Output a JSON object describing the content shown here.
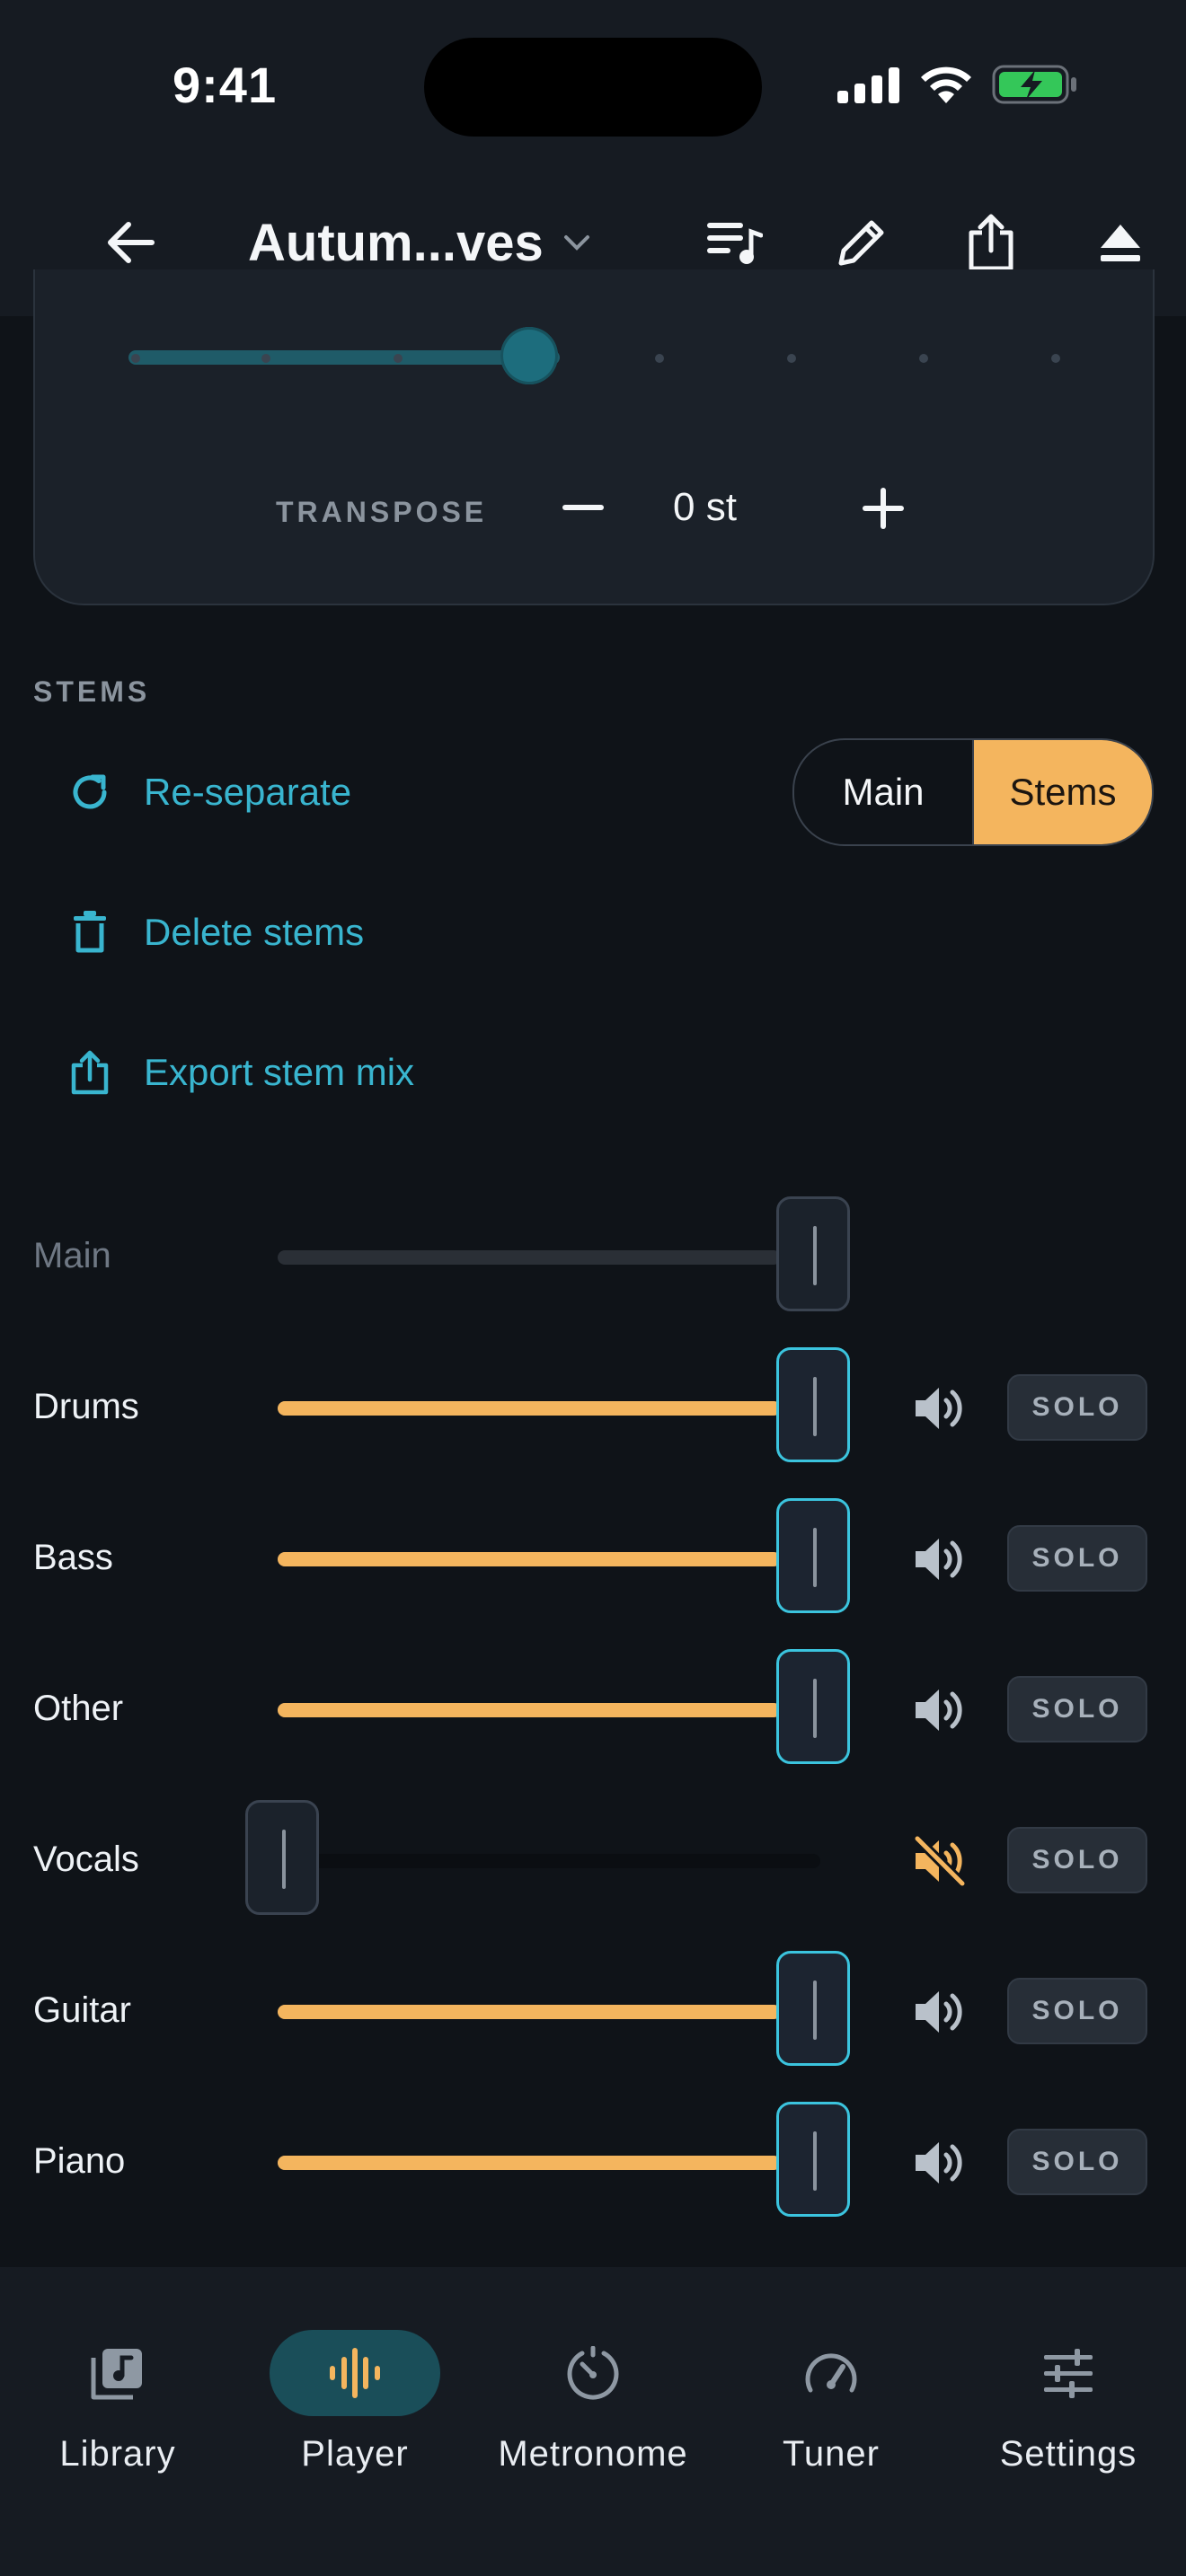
{
  "status_bar": {
    "time": "9:41"
  },
  "header": {
    "title": "Autum...ves"
  },
  "transpose": {
    "label": "TRANSPOSE",
    "value": "0 st"
  },
  "stems": {
    "section_label": "STEMS",
    "actions": [
      {
        "label": "Re-separate",
        "icon": "refresh-icon"
      },
      {
        "label": "Delete stems",
        "icon": "trash-icon"
      },
      {
        "label": "Export stem mix",
        "icon": "share-icon"
      }
    ],
    "mode_toggle": {
      "options": [
        "Main",
        "Stems"
      ],
      "selected": "Stems"
    },
    "solo_label": "SOLO",
    "rows": [
      {
        "name": "Main",
        "level": 1.0,
        "disabled": true
      },
      {
        "name": "Drums",
        "level": 1.0,
        "muted": false
      },
      {
        "name": "Bass",
        "level": 1.0,
        "muted": false
      },
      {
        "name": "Other",
        "level": 1.0,
        "muted": false
      },
      {
        "name": "Vocals",
        "level": 0.0,
        "muted": true
      },
      {
        "name": "Guitar",
        "level": 1.0,
        "muted": false
      },
      {
        "name": "Piano",
        "level": 1.0,
        "muted": false
      }
    ]
  },
  "nav": {
    "items": [
      {
        "label": "Library",
        "icon": "library-icon"
      },
      {
        "label": "Player",
        "icon": "waveform-icon",
        "active": true
      },
      {
        "label": "Metronome",
        "icon": "metronome-icon"
      },
      {
        "label": "Tuner",
        "icon": "gauge-icon"
      },
      {
        "label": "Settings",
        "icon": "sliders-icon"
      }
    ]
  },
  "colors": {
    "accent": "#f4b55e",
    "link": "#39b5cf",
    "thumb_border": "#3bc4de",
    "background": "#0f1318"
  }
}
